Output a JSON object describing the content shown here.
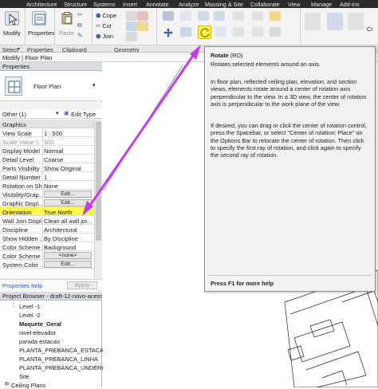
{
  "ribbon": {
    "tabs": [
      "Architecture",
      "Structure",
      "Systems",
      "Insert",
      "Annotate",
      "Analyze",
      "Massing & Site",
      "Collaborate",
      "View",
      "Manage",
      "Add-Ins"
    ],
    "modify_label": "Modify",
    "properties_label": "Properties",
    "cope_label": "Cope",
    "cut_label": "Cut",
    "join_label": "Join",
    "paste_label": "Paste",
    "panel_select": "Select",
    "panel_properties": "Properties",
    "panel_clipboard": "Clipboard",
    "panel_geometry": "Geometry",
    "panel_cr": "Cr",
    "context_title": "Modify | Floor Plan"
  },
  "properties": {
    "title": "Properties",
    "type_name": "Floor Plan",
    "filter": "Other (1)",
    "edit_type": "Edit Type",
    "group_graphics": "Graphics",
    "rows": [
      {
        "k": "View Scale",
        "v": "1 : 500"
      },
      {
        "k": "Scale Value   1:",
        "v": "500"
      },
      {
        "k": "Display Model",
        "v": "Normal"
      },
      {
        "k": "Detail Level",
        "v": "Coarse"
      },
      {
        "k": "Parts Visibility",
        "v": "Show Original"
      },
      {
        "k": "Detail Number",
        "v": "1"
      },
      {
        "k": "Rotation on Sh...",
        "v": "None"
      },
      {
        "k": "Visibility/Grap...",
        "btn": "Edit..."
      },
      {
        "k": "Graphic Displ...",
        "btn": "Edit..."
      },
      {
        "k": "Orientation",
        "v": "True North"
      },
      {
        "k": "Wall Join Displ...",
        "v": "Clean all wall joi..."
      },
      {
        "k": "Discipline",
        "v": "Architectural"
      },
      {
        "k": "Show Hidden ...",
        "v": "By Discipline"
      },
      {
        "k": "Color Scheme ...",
        "v": "Background"
      },
      {
        "k": "Color Scheme",
        "btn": "<none>"
      },
      {
        "k": "System Color ...",
        "btn": "Edit..."
      }
    ],
    "help": "Properties help",
    "apply": "Apply"
  },
  "browser": {
    "title": "Project Browser - draft-12-novo-acess...",
    "items": [
      "Level -1",
      "Level -2",
      "Maquete_Geral",
      "nivel-elevador",
      "parada estacao",
      "PLANTA_PREBANCA_ESTACA",
      "PLANTA_PREBANCA_LINHA",
      "PLANTA_PREBANCA_UNDERG",
      "Site",
      "Ceiling Plans"
    ]
  },
  "tooltip": {
    "title": "Rotate",
    "shortcut": "(RO)",
    "summary": "Rotates selected elements around an axis.",
    "para1": "In floor plan, reflected ceiling plan, elevation, and section views, elements rotate around a center of rotation axis perpendicular to the view. In a 3D view, the center of rotation axis is perpendicular to the work plane of the view.",
    "para2": "If desired, you can drag or click the center of rotation control, press the Spacebar, or select \"Center of rotation: Place\" on the Options Bar to relocate the center of rotation. Then click to specify the first ray of rotation, and click again to specify the second ray of rotation.",
    "footer": "Press F1 for more help"
  },
  "colors": {
    "highlight": "#fff64f",
    "arrow": "#c23cf0",
    "tab_bar": "#2b2b2b"
  }
}
